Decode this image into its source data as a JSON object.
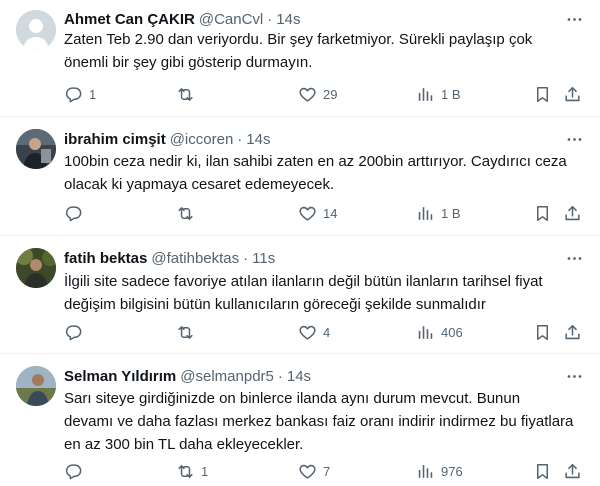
{
  "tweets": [
    {
      "name": "Ahmet Can ÇAKIR",
      "handle": "@CanCvl",
      "dot": "·",
      "time": "14s",
      "avatar": "default-avatar",
      "text_lines": [
        "Zaten Teb 2.90 dan veriyordu. Bir şey farketmiyor. Sürekli paylaşıp çok",
        "önemli bir şey gibi gösterip durmayın."
      ],
      "replies": "1",
      "retweets": "",
      "likes": "29",
      "views": "1 B"
    },
    {
      "name": "ibrahim cimşit",
      "handle": "@iccoren",
      "dot": "·",
      "time": "14s",
      "avatar": "photo-avatar",
      "text_lines": [
        "100bin ceza nedir ki, ilan sahibi zaten en az 200bin arttırıyor. Caydırıcı ceza",
        "olacak ki yapmaya cesaret edemeyecek."
      ],
      "replies": "",
      "retweets": "",
      "likes": "14",
      "views": "1 B"
    },
    {
      "name": "fatih bektas",
      "handle": "@fatihbektas",
      "dot": "·",
      "time": "11s",
      "avatar": "photo-avatar",
      "text_lines": [
        "İlgili site sadece favoriye atılan ilanların değil bütün ilanların tarihsel fiyat",
        "değişim bilgisini bütün kullanıcıların göreceği şekilde sunmalıdır"
      ],
      "replies": "",
      "retweets": "",
      "likes": "4",
      "views": "406"
    },
    {
      "name": "Selman Yıldırım",
      "handle": "@selmanpdr5",
      "dot": "·",
      "time": "14s",
      "avatar": "photo-avatar",
      "text_lines": [
        "Sarı siteye girdiğinizde on binlerce ilanda aynı durum mevcut. Bunun",
        "devamı ve daha fazlası merkez bankası faiz oranı indirir indirmez bu fiyatlara",
        "en az 300 bin TL daha ekleyecekler."
      ],
      "replies": "",
      "retweets": "1",
      "likes": "7",
      "views": "976"
    }
  ],
  "colors": {
    "text": "#0f1419",
    "muted": "#536471",
    "divider": "#eff3f4"
  }
}
